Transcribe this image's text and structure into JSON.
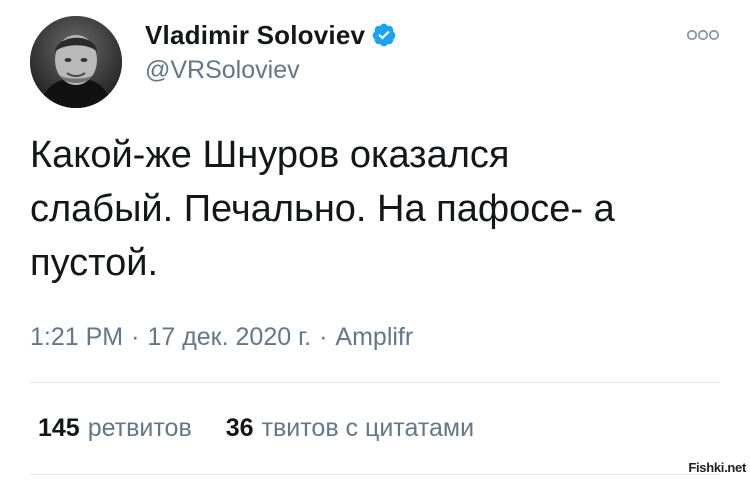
{
  "tweet": {
    "author": {
      "display_name": "Vladimir Soloviev",
      "handle": "@VRSoloviev",
      "verified": true,
      "avatar_icon": "avatar-photo"
    },
    "text": "Какой-же Шнуров оказался\nслабый. Печально. На пафосе- а\nпустой.",
    "meta": {
      "time": "1:21 PM",
      "separator": "·",
      "date": "17 дек. 2020 г.",
      "source": "Amplifr"
    },
    "stats": {
      "retweets_count": "145",
      "retweets_label": "ретвитов",
      "quotes_count": "36",
      "quotes_label": "твитов с цитатами"
    },
    "more_icon": "more-options-icon"
  },
  "watermark": "Fishki.net",
  "colors": {
    "verified_blue": "#1da1f2",
    "secondary_text": "#657786",
    "primary_text": "#14171a",
    "divider": "#e1e8ed"
  }
}
